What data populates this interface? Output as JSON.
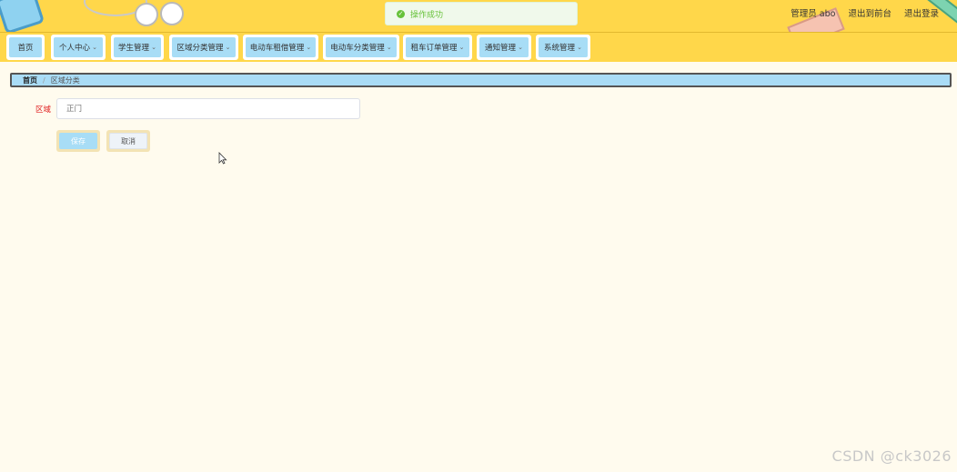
{
  "toast": {
    "icon": "check-circle-icon",
    "message": "操作成功"
  },
  "user": {
    "greeting": "管理员 abo",
    "to_front": "退出到前台",
    "logout": "退出登录"
  },
  "nav": {
    "items": [
      {
        "label": "首页",
        "has_menu": false
      },
      {
        "label": "个人中心",
        "has_menu": true
      },
      {
        "label": "学生管理",
        "has_menu": true
      },
      {
        "label": "区域分类管理",
        "has_menu": true
      },
      {
        "label": "电动车租借管理",
        "has_menu": true
      },
      {
        "label": "电动车分类管理",
        "has_menu": true
      },
      {
        "label": "租车订单管理",
        "has_menu": true
      },
      {
        "label": "通知管理",
        "has_menu": true
      },
      {
        "label": "系统管理",
        "has_menu": true
      }
    ],
    "chevron": "chevron-down-icon"
  },
  "breadcrumb": {
    "home": "首页",
    "separator": "/",
    "current": "区域分类"
  },
  "form": {
    "field_label": "区域",
    "required_mark": "",
    "field_value": "",
    "field_placeholder": "正门",
    "save_label": "保存",
    "cancel_label": "取消"
  },
  "watermark": "CSDN @ck3026",
  "colors": {
    "header_bg": "#ffd74a",
    "nav_item_bg": "#a8ddf6",
    "page_bg": "#fffbee",
    "toast_text": "#67c23a"
  }
}
